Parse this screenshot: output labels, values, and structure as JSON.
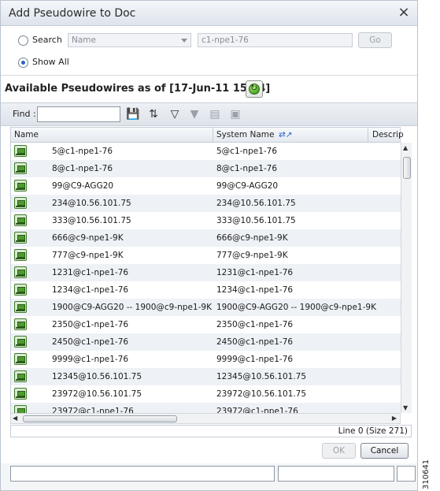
{
  "dialog": {
    "title": "Add Pseudowire to Doc",
    "close_label": "×"
  },
  "search": {
    "search_label": "Search",
    "show_all_label": "Show All",
    "selected_option": "Show All",
    "field_select_value": "Name",
    "search_value": "c1-npe1-76",
    "go_label": "Go"
  },
  "available": {
    "title": "Available Pseudowires as of [17-Jun-11 15:14]"
  },
  "toolbar": {
    "find_label": "Find :",
    "find_value": ""
  },
  "grid": {
    "columns": [
      "Name",
      "System Name",
      "Descrip"
    ],
    "rows": [
      {
        "name": "5@c1-npe1-76",
        "system_name": "5@c1-npe1-76"
      },
      {
        "name": "8@c1-npe1-76",
        "system_name": "8@c1-npe1-76"
      },
      {
        "name": "99@C9-AGG20",
        "system_name": "99@C9-AGG20"
      },
      {
        "name": "234@10.56.101.75",
        "system_name": "234@10.56.101.75"
      },
      {
        "name": "333@10.56.101.75",
        "system_name": "333@10.56.101.75"
      },
      {
        "name": "666@c9-npe1-9K",
        "system_name": "666@c9-npe1-9K"
      },
      {
        "name": "777@c9-npe1-9K",
        "system_name": "777@c9-npe1-9K"
      },
      {
        "name": "1231@c1-npe1-76",
        "system_name": "1231@c1-npe1-76"
      },
      {
        "name": "1234@c1-npe1-76",
        "system_name": "1234@c1-npe1-76"
      },
      {
        "name": "1900@C9-AGG20 -- 1900@c9-npe1-9K",
        "system_name": "1900@C9-AGG20 -- 1900@c9-npe1-9K"
      },
      {
        "name": "2350@c1-npe1-76",
        "system_name": "2350@c1-npe1-76"
      },
      {
        "name": "2450@c1-npe1-76",
        "system_name": "2450@c1-npe1-76"
      },
      {
        "name": "9999@c1-npe1-76",
        "system_name": "9999@c1-npe1-76"
      },
      {
        "name": "12345@10.56.101.75",
        "system_name": "12345@10.56.101.75"
      },
      {
        "name": "23972@10.56.101.75",
        "system_name": "23972@10.56.101.75"
      },
      {
        "name": "23972@c1-npe1-76",
        "system_name": "23972@c1-npe1-76"
      }
    ]
  },
  "status": {
    "line_text": "Line 0 (Size 271)"
  },
  "buttons": {
    "ok_label": "OK",
    "cancel_label": "Cancel"
  },
  "side_code": "310641",
  "icons": {
    "close": "close-icon",
    "refresh": "refresh-icon",
    "pseudowire": "pseudowire-icon",
    "save": "save-icon",
    "sort": "sort-icon",
    "filter": "filter-icon",
    "clear_filter": "clear-filter-icon",
    "export": "export-icon",
    "print": "print-icon"
  }
}
